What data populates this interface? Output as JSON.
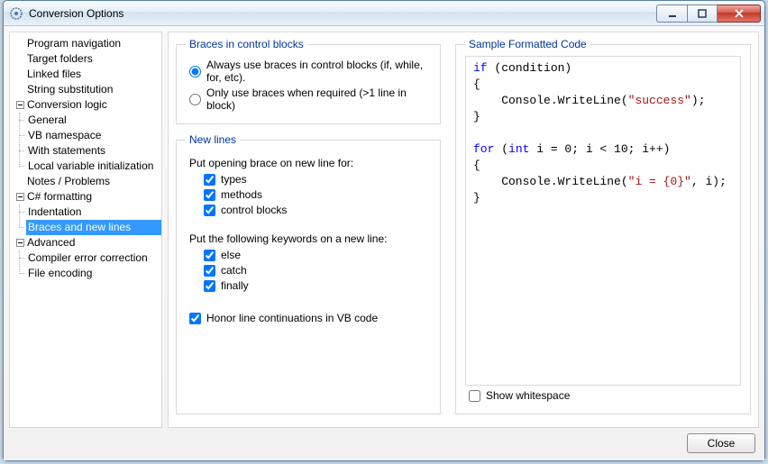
{
  "window": {
    "title": "Conversion Options"
  },
  "tree": {
    "program_navigation": "Program navigation",
    "target_folders": "Target folders",
    "linked_files": "Linked files",
    "string_substitution": "String substitution",
    "conversion_logic": "Conversion logic",
    "general": "General",
    "vb_namespace": "VB namespace",
    "with_statements": "With statements",
    "local_var_init": "Local variable initialization",
    "notes_problems": "Notes / Problems",
    "csharp_formatting": "C# formatting",
    "indentation": "Indentation",
    "braces_newlines": "Braces and new lines",
    "advanced": "Advanced",
    "compiler_error_correction": "Compiler error correction",
    "file_encoding": "File encoding"
  },
  "braces_group": {
    "legend": "Braces in control blocks",
    "opt_always": "Always use braces in control blocks (if, while, for, etc).",
    "opt_required": "Only use braces when required (>1 line in block)"
  },
  "newlines_group": {
    "legend": "New lines",
    "put_opening": "Put opening brace on new line for:",
    "types": "types",
    "methods": "methods",
    "control_blocks": "control blocks",
    "put_keywords": "Put the following keywords on a new line:",
    "else": "else",
    "catch": "catch",
    "finally": "finally",
    "honor_vb": "Honor line continuations in VB code"
  },
  "sample": {
    "legend": "Sample Formatted Code",
    "show_whitespace": "Show whitespace",
    "code": {
      "l1a": "if",
      "l1b": " (condition)",
      "l2": "{",
      "l3a": "    Console.WriteLine(",
      "l3b": "\"success\"",
      "l3c": ");",
      "l4": "}",
      "l5": "",
      "l6a": "for",
      "l6b": " (",
      "l6c": "int",
      "l6d": " i = 0; i < 10; i++)",
      "l7": "{",
      "l8a": "    Console.WriteLine(",
      "l8b": "\"i = {0}\"",
      "l8c": ", i);",
      "l9": "}"
    }
  },
  "footer": {
    "close": "Close"
  }
}
